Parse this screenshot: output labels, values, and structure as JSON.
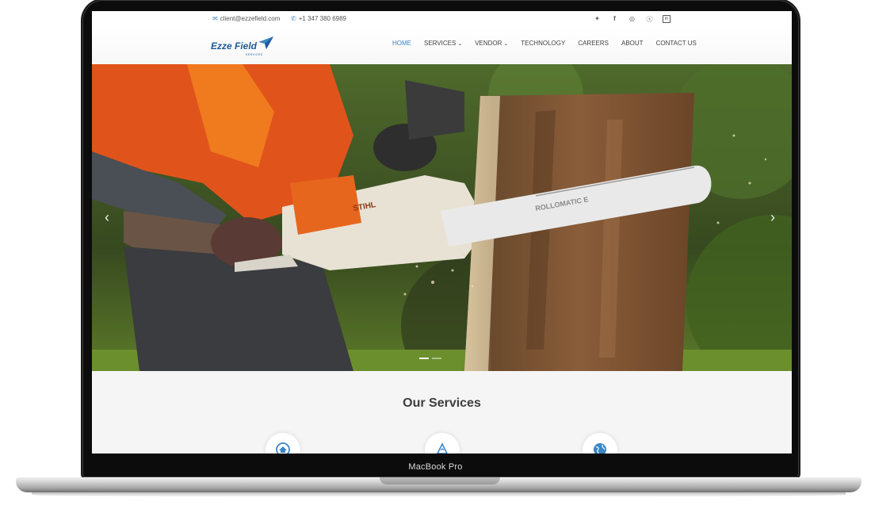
{
  "device": {
    "model_label": "MacBook Pro"
  },
  "topbar": {
    "email": "client@ezzefield.com",
    "phone": "+1 347 380 6989",
    "email_icon": "envelope-icon",
    "phone_icon": "phone-icon",
    "socials": [
      "twitter-icon",
      "facebook-icon",
      "instagram-icon",
      "skype-icon",
      "linkedin-icon"
    ],
    "social_glyphs": [
      "𝕪",
      "f",
      "◎",
      "ⓢ",
      "in"
    ]
  },
  "nav": {
    "logo_text": "Ezze Field",
    "logo_sub": "SERVICES",
    "items": [
      {
        "label": "HOME",
        "active": true
      },
      {
        "label": "SERVICES",
        "dropdown": true
      },
      {
        "label": "VENDOR",
        "dropdown": true
      },
      {
        "label": "TECHNOLOGY"
      },
      {
        "label": "CAREERS"
      },
      {
        "label": "ABOUT"
      },
      {
        "label": "CONTACT US"
      }
    ]
  },
  "hero": {
    "slide_count": 2,
    "active_slide": 1,
    "saw_brand": "STIHL",
    "bar_label": "ROLLOMATIC E"
  },
  "services": {
    "title": "Our Services",
    "icons": [
      "home-icon",
      "tree-icon",
      "globe-icon"
    ]
  },
  "colors": {
    "accent": "#3b86c6",
    "logo": "#1d5a9c"
  }
}
